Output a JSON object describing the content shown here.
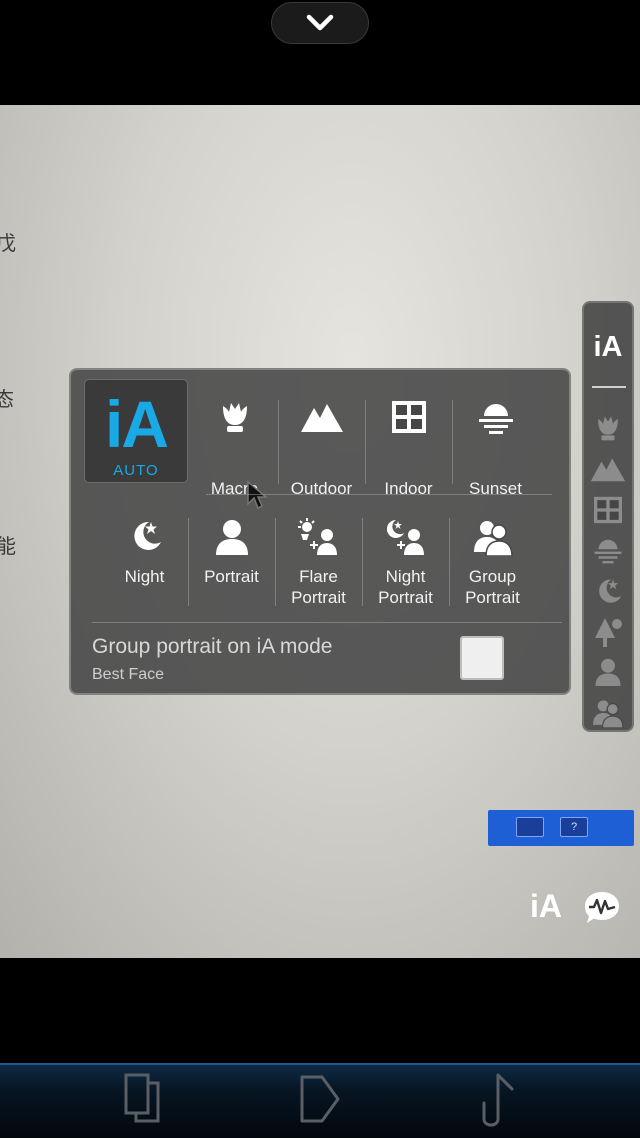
{
  "colors": {
    "accent_blue": "#19a9e6",
    "panel_bg": "#464646",
    "label_text": "#f2f2f2"
  },
  "auto_mode": {
    "logo": "iA",
    "label": "AUTO"
  },
  "scenes_row1": [
    {
      "label": "Macro",
      "icon": "tulip-icon"
    },
    {
      "label": "Outdoor",
      "icon": "mountain-icon"
    },
    {
      "label": "Indoor",
      "icon": "window-icon"
    },
    {
      "label": "Sunset",
      "icon": "sunset-icon"
    }
  ],
  "scenes_row2": [
    {
      "label": "Night",
      "icon": "moon-star-icon"
    },
    {
      "label": "Portrait",
      "icon": "person-icon"
    },
    {
      "label": "Flare Portrait",
      "icon": "flare-portrait-icon"
    },
    {
      "label": "Night Portrait",
      "icon": "night-portrait-icon"
    },
    {
      "label": "Group Portrait",
      "icon": "group-icon"
    }
  ],
  "group_option": {
    "title": "Group portrait on iA mode",
    "subtitle": "Best Face",
    "checked": false
  },
  "scene_rail": {
    "title": "iA",
    "icons": [
      "tulip-icon",
      "mountain-icon",
      "window-icon",
      "sunset-icon",
      "moon-star-icon",
      "tree-icon",
      "person-icon",
      "group-icon"
    ]
  },
  "viewfinder": {
    "ia_label": "iA",
    "background_chars": [
      "戊",
      "态",
      "能"
    ]
  },
  "nav": [
    "recent-apps-icon",
    "home-icon",
    "back-icon"
  ]
}
